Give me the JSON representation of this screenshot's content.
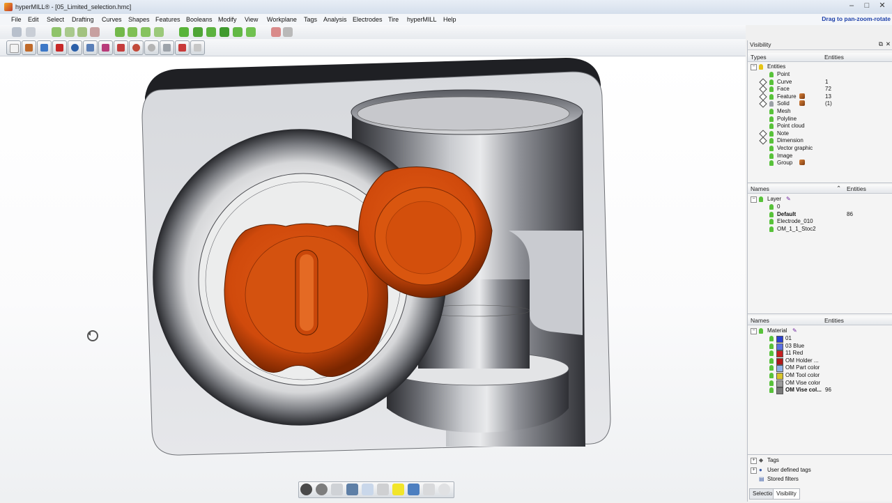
{
  "window": {
    "app_name": "hyperMILL®",
    "file": "[05_Limited_selection.hmc]"
  },
  "menu": [
    "File",
    "Edit",
    "Select",
    "Drafting",
    "Curves",
    "Shapes",
    "Features",
    "Booleans",
    "Modify",
    "View",
    "Workplane",
    "Tags",
    "Analysis",
    "Electrodes",
    "Tire",
    "hyperMILL",
    "Help"
  ],
  "hint": "Drag to pan-zoom-rotate",
  "panel": {
    "title": "Visibility",
    "types": {
      "col1": "Types",
      "col2": "Entities",
      "root": "Entities",
      "items": [
        {
          "label": "Point",
          "value": ""
        },
        {
          "label": "Curve",
          "value": "1"
        },
        {
          "label": "Face",
          "value": "72"
        },
        {
          "label": "Feature",
          "value": "13"
        },
        {
          "label": "Solid",
          "value": "(1)"
        },
        {
          "label": "Mesh",
          "value": ""
        },
        {
          "label": "Polyline",
          "value": ""
        },
        {
          "label": "Point cloud",
          "value": ""
        },
        {
          "label": "Note",
          "value": ""
        },
        {
          "label": "Dimension",
          "value": ""
        },
        {
          "label": "Vector graphic",
          "value": ""
        },
        {
          "label": "Image",
          "value": ""
        },
        {
          "label": "Group",
          "value": ""
        }
      ]
    },
    "layers": {
      "col1": "Names",
      "col2": "Entities",
      "root": "Layer",
      "items": [
        {
          "label": "0",
          "value": ""
        },
        {
          "label": "Default",
          "value": "86"
        },
        {
          "label": "Electrode_010",
          "value": ""
        },
        {
          "label": "OM_1_1_Stoc2",
          "value": ""
        }
      ]
    },
    "materials": {
      "col1": "Names",
      "col2": "Entities",
      "root": "Material",
      "items": [
        {
          "label": "01",
          "value": "",
          "color": "#2a3fd1"
        },
        {
          "label": "03 Blue",
          "value": "",
          "color": "#5a6fe0"
        },
        {
          "label": "11 Red",
          "value": "",
          "color": "#c62020"
        },
        {
          "label": "OM Holder ...",
          "value": "",
          "color": "#b01818"
        },
        {
          "label": "OM Part color",
          "value": "",
          "color": "#8fb0e8"
        },
        {
          "label": "OM Tool color",
          "value": "",
          "color": "#d8c42a"
        },
        {
          "label": "OM Vise color",
          "value": "",
          "color": "#9a9a9a"
        },
        {
          "label": "OM Vise col...",
          "value": "96",
          "color": "#7a7a7a"
        }
      ]
    },
    "tags": {
      "root": "Tags",
      "user": "User defined tags",
      "stored": "Stored filters"
    },
    "tabs": [
      "Selection",
      "Visibility"
    ]
  }
}
